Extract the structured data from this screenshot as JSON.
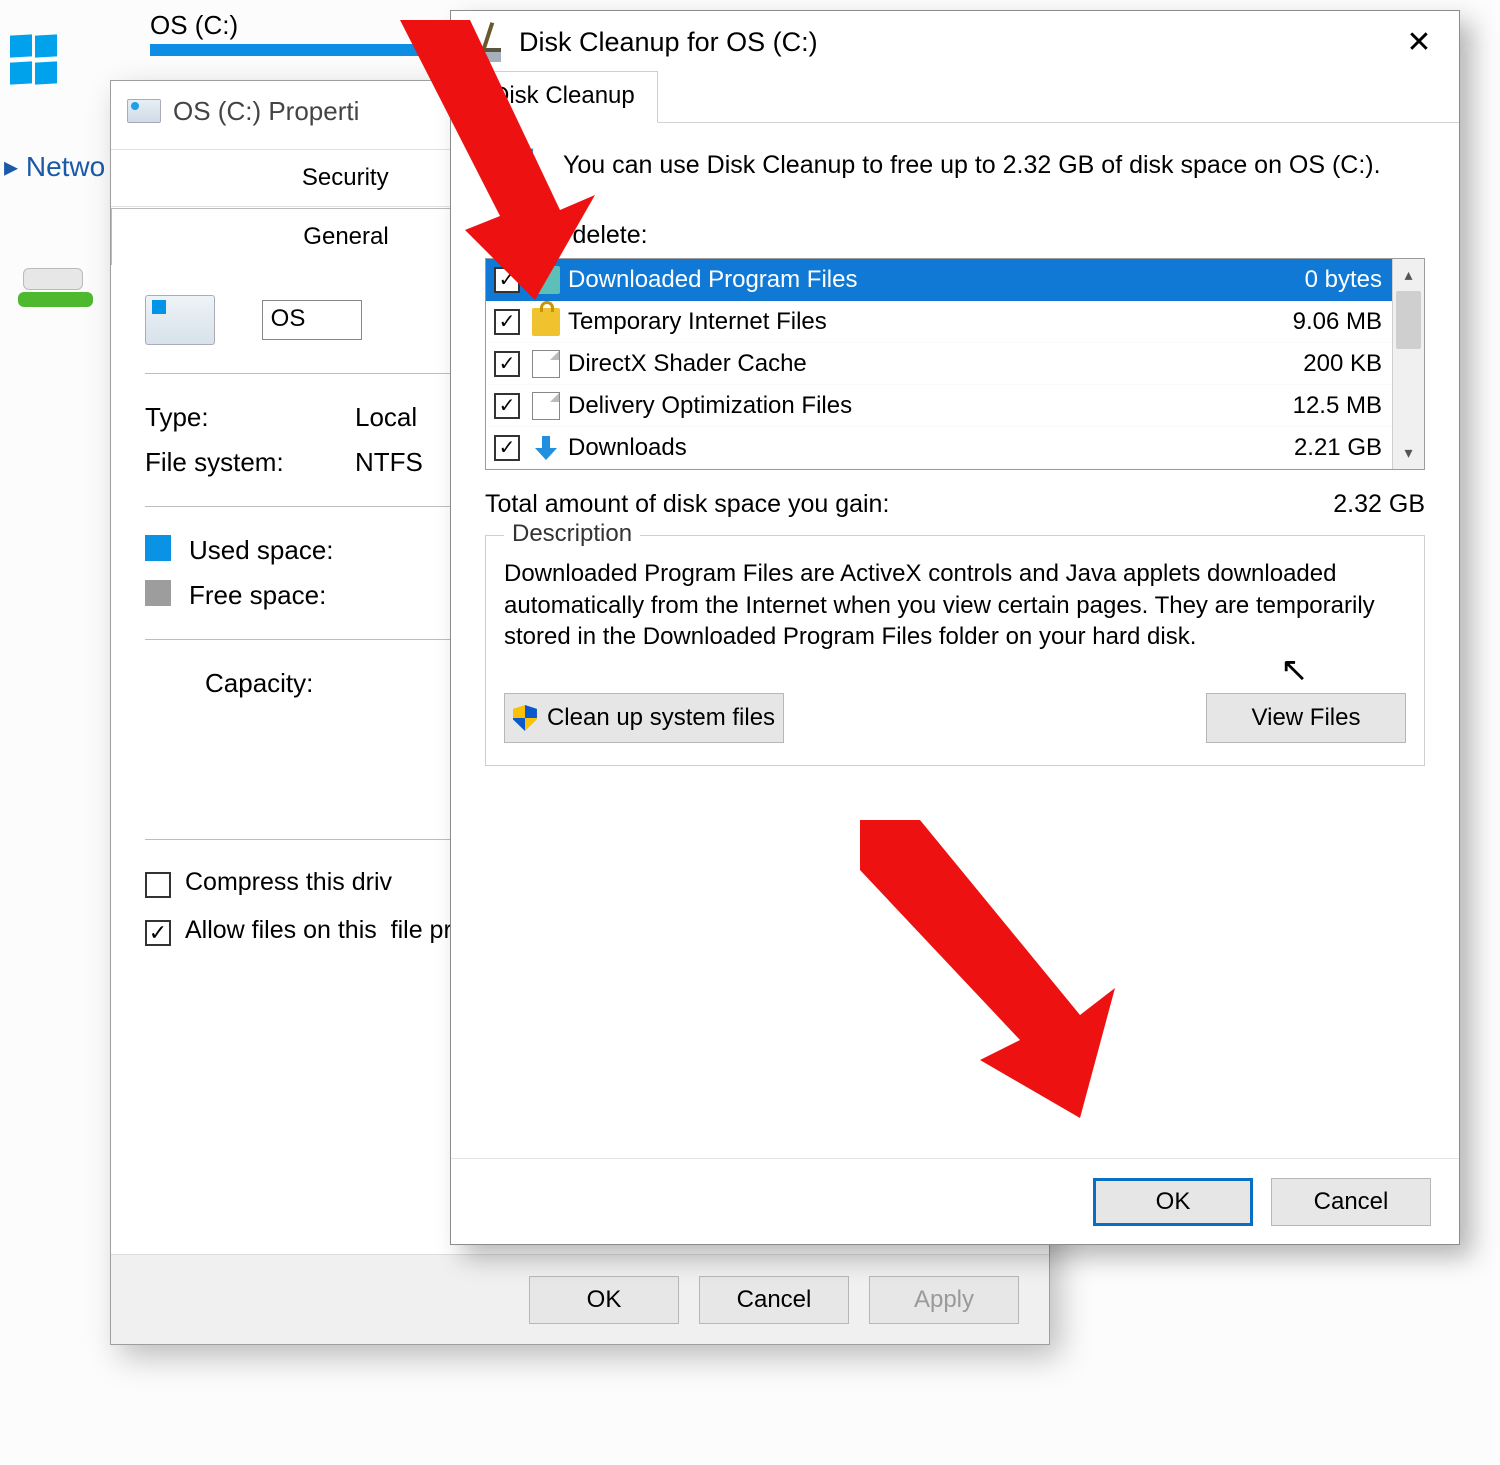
{
  "explorer": {
    "drive_label": "OS (C:)",
    "network_label": "Netwo"
  },
  "properties": {
    "title": "OS (C:) Properti",
    "tabs_row1": [
      "Security"
    ],
    "tabs_row2": {
      "active": "General"
    },
    "drive_name_value": "OS",
    "type_label": "Type:",
    "type_value": "Local",
    "fs_label": "File system:",
    "fs_value": "NTFS",
    "used_label": "Used space:",
    "free_label": "Free space:",
    "capacity_label": "Capacity:",
    "compress_label": "Compress this driv",
    "allow_label": "Allow files on this  file properties",
    "buttons": {
      "ok": "OK",
      "cancel": "Cancel",
      "apply": "Apply"
    }
  },
  "cleanup": {
    "title": "Disk Cleanup for OS (C:)",
    "tab": "Disk Cleanup",
    "info_text": "You can use Disk Cleanup to free up to 2.32 GB of disk space on OS (C:).",
    "files_label": "Files to delete:",
    "files": [
      {
        "name": "Downloaded Program Files",
        "size": "0 bytes",
        "checked": true,
        "selected": true,
        "icon": "folder"
      },
      {
        "name": "Temporary Internet Files",
        "size": "9.06 MB",
        "checked": true,
        "selected": false,
        "icon": "lock"
      },
      {
        "name": "DirectX Shader Cache",
        "size": "200 KB",
        "checked": true,
        "selected": false,
        "icon": "doc"
      },
      {
        "name": "Delivery Optimization Files",
        "size": "12.5 MB",
        "checked": true,
        "selected": false,
        "icon": "doc"
      },
      {
        "name": "Downloads",
        "size": "2.21 GB",
        "checked": true,
        "selected": false,
        "icon": "down"
      }
    ],
    "total_label": "Total amount of disk space you gain:",
    "total_value": "2.32 GB",
    "description_header": "Description",
    "description_text": "Downloaded Program Files are ActiveX controls and Java applets downloaded automatically from the Internet when you view certain pages. They are temporarily stored in the Downloaded Program Files folder on your hard disk.",
    "clean_system_label": "Clean up system files",
    "view_files_label": "View Files",
    "ok_label": "OK",
    "cancel_label": "Cancel"
  }
}
